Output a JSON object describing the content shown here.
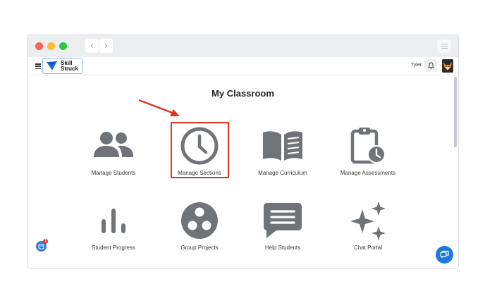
{
  "browser": {
    "back_icon": "chevron-left-icon",
    "forward_icon": "chevron-right-icon",
    "menu_icon": "menu-lines-icon"
  },
  "header": {
    "logo_line1": "Skill",
    "logo_line2": "Struck",
    "user_name": "Tyler"
  },
  "page": {
    "title": "My Classroom"
  },
  "tiles": [
    {
      "label": "Manage Students",
      "icon": "students-icon"
    },
    {
      "label": "Manage Sections",
      "icon": "clock-icon"
    },
    {
      "label": "Manage Curriculum",
      "icon": "book-icon"
    },
    {
      "label": "Manage Assessments",
      "icon": "clipboard-clock-icon"
    },
    {
      "label": "Student Progress",
      "icon": "bar-chart-icon"
    },
    {
      "label": "Group Projects",
      "icon": "group-circles-icon"
    },
    {
      "label": "Help Students",
      "icon": "chat-bubble-icon"
    },
    {
      "label": "Chat Portal",
      "icon": "sparkle-icon"
    }
  ],
  "widgets": {
    "notification_count": "1"
  },
  "colors": {
    "icon_gray": "#707378",
    "accent_blue": "#1f7ae0",
    "highlight_red": "#e8321e"
  }
}
